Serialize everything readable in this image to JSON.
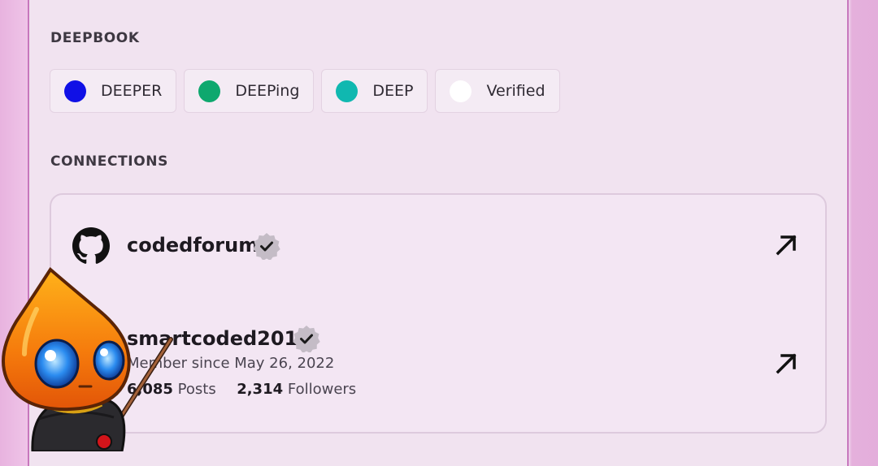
{
  "roles_section": {
    "title": "DEEPBOOK",
    "roles": [
      {
        "label": "DEEPER",
        "color": "#1010e6"
      },
      {
        "label": "DEEPing",
        "color": "#0ea86e"
      },
      {
        "label": "DEEP",
        "color": "#10b8b0"
      },
      {
        "label": "Verified",
        "color": "#ffffff"
      }
    ]
  },
  "connections_section": {
    "title": "CONNECTIONS",
    "items": [
      {
        "icon": "github-icon",
        "name": "codedforum",
        "verified": true
      },
      {
        "icon": "reddit-icon",
        "name": "smartcoded2011",
        "verified": true,
        "member_since": "Member since May 26, 2022",
        "posts_count": "6,085",
        "posts_label": "Posts",
        "followers_count": "2,314",
        "followers_label": "Followers"
      }
    ]
  },
  "colors": {
    "accent_border": "#c777bd",
    "panel_bg": "#f1e3f0"
  }
}
